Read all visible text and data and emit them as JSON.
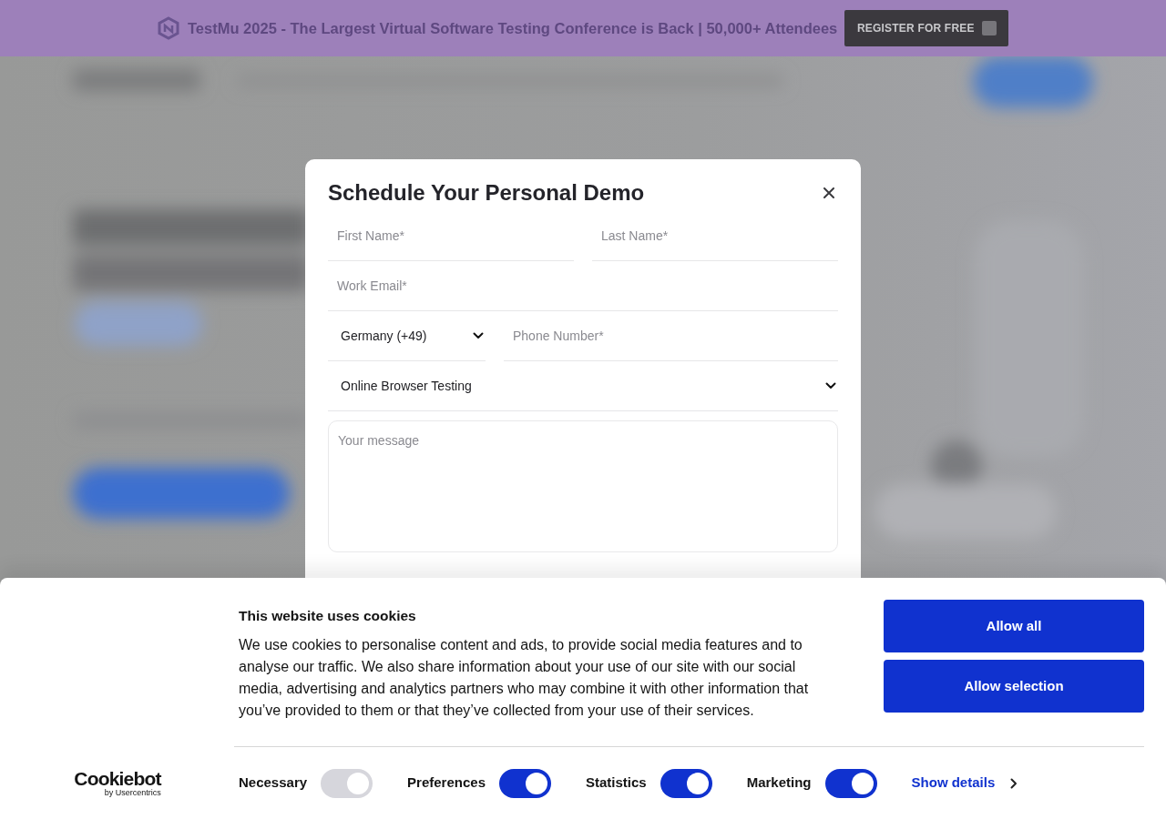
{
  "announcement_bar": {
    "text": "TestMu 2025 - The Largest Virtual Software Testing Conference is Back | 50,000+ Attendees",
    "button": "REGISTER FOR FREE"
  },
  "demo_modal": {
    "title": "Schedule Your Personal Demo",
    "rows": [
      {
        "fields": [
          {
            "kind": "input",
            "placeholder": "First Name*"
          },
          {
            "kind": "input",
            "placeholder": "Last Name*"
          }
        ]
      },
      {
        "fields": [
          {
            "kind": "input",
            "placeholder": "Work Email*"
          }
        ]
      },
      {
        "fields": [
          {
            "kind": "select",
            "value": "Germany (+49)"
          },
          {
            "kind": "input",
            "placeholder": "Phone Number*"
          }
        ]
      },
      {
        "fields": [
          {
            "kind": "select",
            "value": "Online Browser Testing"
          }
        ]
      },
      {
        "fields": [
          {
            "kind": "textarea",
            "placeholder": "Your message"
          }
        ]
      }
    ]
  },
  "cookie_banner": {
    "title": "This website uses cookies",
    "text": "We use cookies to personalise content and ads, to provide social media features and to analyse our traffic. We also share information about your use of our site with our social media, advertising and analytics partners who may combine it with other information that you’ve provided to them or that they’ve collected from your use of their services.",
    "buttons": [
      "Allow all",
      "Allow selection"
    ],
    "logo": {
      "name": "Cookiebot",
      "tagline": "by Usercentrics"
    },
    "toggles": [
      {
        "label": "Necessary",
        "on": true,
        "disabled": true
      },
      {
        "label": "Preferences",
        "on": true,
        "disabled": false
      },
      {
        "label": "Statistics",
        "on": true,
        "disabled": false
      },
      {
        "label": "Marketing",
        "on": true,
        "disabled": false
      }
    ],
    "details_link": "Show details"
  }
}
